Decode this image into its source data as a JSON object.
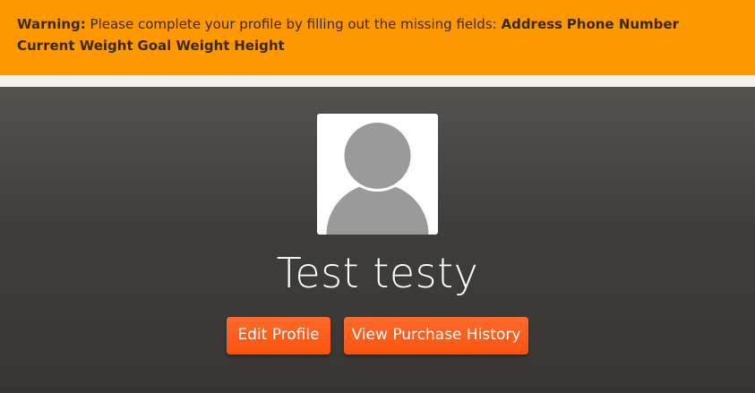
{
  "warning": {
    "prefix": "Warning:",
    "message": " Please complete your profile by filling out the missing fields: ",
    "missing_fields": [
      "Address",
      "Phone Number",
      "Current Weight",
      "Goal Weight",
      "Height"
    ]
  },
  "profile": {
    "avatar_icon": "default-user-avatar",
    "name": "Test testy"
  },
  "actions": {
    "edit_profile_label": "Edit Profile",
    "view_purchase_history_label": "View Purchase History"
  },
  "colors": {
    "warning_bg": "#fe9800",
    "button_accent": "#fb5310",
    "hero_bg": "#403e3b"
  }
}
